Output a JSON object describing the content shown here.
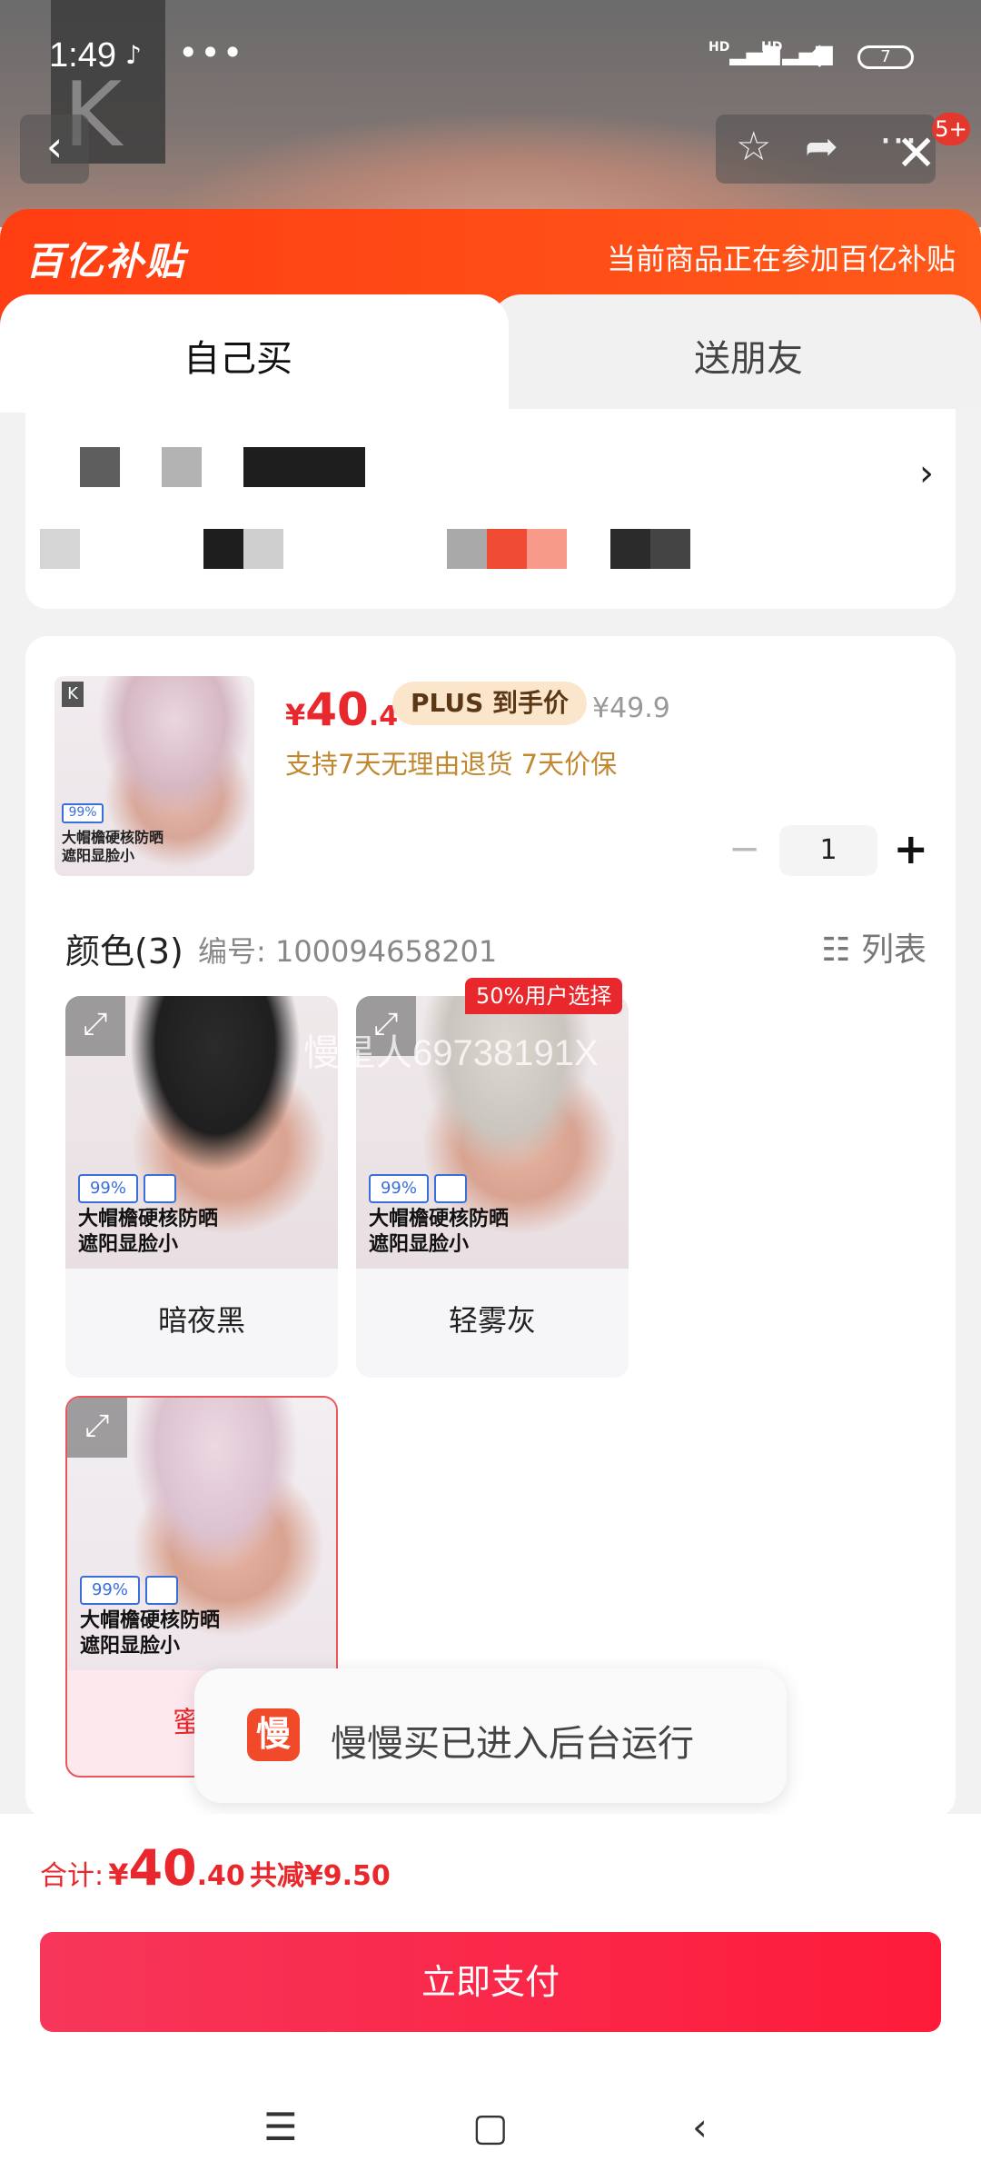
{
  "status": {
    "time": "1:49",
    "dots": "•••",
    "battery": "7",
    "signal1": "HD",
    "signal2": "HD"
  },
  "header": {
    "badge_count": "5+"
  },
  "banner": {
    "brand": "百亿补贴",
    "note": "当前商品正在参加百亿补贴"
  },
  "tabs": [
    {
      "label": "自己买"
    },
    {
      "label": "送朋友"
    }
  ],
  "product": {
    "currency": "¥",
    "price_int": "40",
    "price_dec": ".4",
    "plus_label": "PLUS 到手价",
    "old_price": "¥49.9",
    "promises": "支持7天无理由退货  7天价保",
    "quantity": "1",
    "minus": "−",
    "plus": "+",
    "thumb_caption": "大帽檐硬核防晒\n遮阳显脸小",
    "thumb_pct": "99%"
  },
  "colors": {
    "heading": "颜色(3)",
    "sku_label": "编号: 100094658201",
    "list_toggle": "列表",
    "hot_badge": "50%用户选择",
    "watermark": "慢星人69738191X",
    "options": [
      {
        "name": "暗夜黑",
        "caption": "大帽檐硬核防晒\n遮阳显脸小",
        "pct": "99%"
      },
      {
        "name": "轻雾灰",
        "caption": "大帽檐硬核防晒\n遮阳显脸小",
        "pct": "99%"
      },
      {
        "name": "蜜桃",
        "caption": "大帽檐硬核防晒\n遮阳显脸小",
        "pct": "99%"
      }
    ]
  },
  "toast": {
    "icon_text": "慢",
    "message": "慢慢买已进入后台运行"
  },
  "footer": {
    "total_label": "合计:",
    "currency": "¥",
    "total_int": "40",
    "total_dec": ".40",
    "savings": "共减¥9.50",
    "pay_label": "立即支付"
  },
  "colors_theme": {
    "accent": "#e8282d",
    "banner": "#ff4416",
    "gold": "#c18830"
  }
}
